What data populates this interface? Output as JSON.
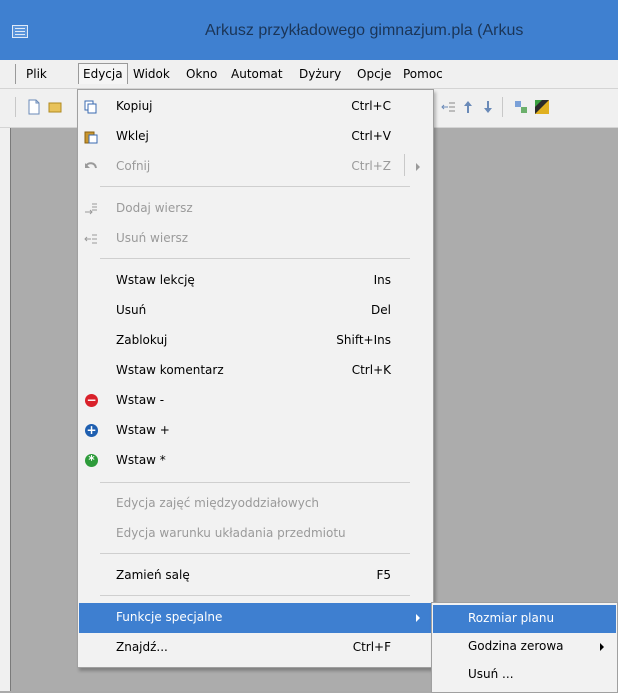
{
  "window": {
    "title": "Arkusz przykładowego gimnazjum.pla (Arkus"
  },
  "menubar": {
    "items": [
      {
        "label": "Plik"
      },
      {
        "label": "Edycja"
      },
      {
        "label": "Widok"
      },
      {
        "label": "Okno"
      },
      {
        "label": "Automat"
      },
      {
        "label": "Dyżury"
      },
      {
        "label": "Opcje"
      },
      {
        "label": "Pomoc"
      }
    ]
  },
  "edit_menu": {
    "copy": {
      "label": "Kopiuj",
      "shortcut": "Ctrl+C",
      "icon": "copy-icon"
    },
    "paste": {
      "label": "Wklej",
      "shortcut": "Ctrl+V",
      "icon": "paste-icon"
    },
    "undo": {
      "label": "Cofnij",
      "shortcut": "Ctrl+Z",
      "icon": "undo-icon"
    },
    "add_row": {
      "label": "Dodaj wiersz",
      "icon": "add-row-icon"
    },
    "delete_row": {
      "label": "Usuń wiersz",
      "icon": "delete-row-icon"
    },
    "insert_lesson": {
      "label": "Wstaw lekcję",
      "shortcut": "Ins"
    },
    "delete": {
      "label": "Usuń",
      "shortcut": "Del"
    },
    "lock": {
      "label": "Zablokuj",
      "shortcut": "Shift+Ins"
    },
    "insert_comment": {
      "label": "Wstaw komentarz",
      "shortcut": "Ctrl+K"
    },
    "insert_minus": {
      "label": "Wstaw -",
      "icon": "red-minus-icon"
    },
    "insert_plus": {
      "label": "Wstaw +",
      "icon": "blue-plus-icon"
    },
    "insert_star": {
      "label": "Wstaw *",
      "icon": "green-star-icon"
    },
    "edit_interclass": {
      "label": "Edycja zajęć międzyoddziałowych"
    },
    "edit_condition": {
      "label": "Edycja warunku układania przedmiotu"
    },
    "swap_room": {
      "label": "Zamień salę",
      "shortcut": "F5"
    },
    "special_functions": {
      "label": "Funkcje specjalne"
    },
    "find": {
      "label": "Znajdź...",
      "shortcut": "Ctrl+F"
    }
  },
  "special_submenu": {
    "plan_size": {
      "label": "Rozmiar planu"
    },
    "zero_hour": {
      "label": "Godzina zerowa"
    },
    "delete": {
      "label": "Usuń ..."
    }
  },
  "colors": {
    "accent": "#3e7fd0",
    "titlebar": "#3f80d0",
    "workspace": "#acacac"
  }
}
